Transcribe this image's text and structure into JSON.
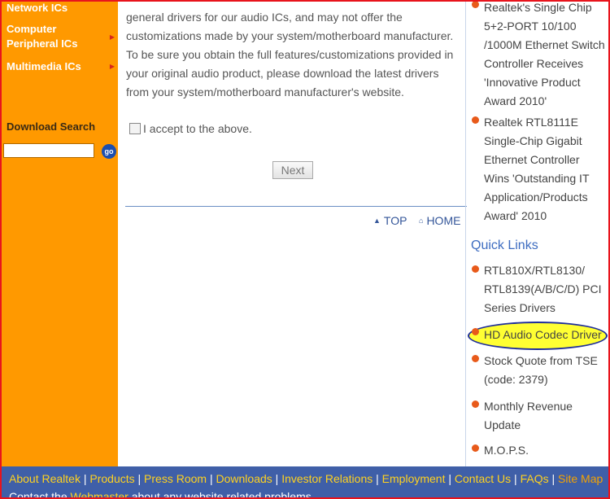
{
  "sidebar": {
    "items": [
      {
        "label": "Network ICs"
      },
      {
        "label": "Computer Peripheral ICs"
      },
      {
        "label": "Multimedia ICs"
      }
    ],
    "download_title": "Download Search",
    "go_label": "go"
  },
  "main": {
    "paragraph": "general drivers for our audio ICs, and may not offer the customizations made by your system/motherboard manufacturer. To be sure you obtain the full features/customizations provided in your original audio product, please download the latest drivers from your system/motherboard manufacturer's website.",
    "accept_label": "I accept to the above.",
    "next_label": "Next",
    "top_label": "TOP",
    "home_label": "HOME"
  },
  "right": {
    "news": [
      {
        "text": "Realtek's Single Chip 5+2-PORT 10/100 /1000M Ethernet Switch Controller Receives 'Innovative Product Award 2010'"
      },
      {
        "text": "Realtek RTL8111E Single-Chip Gigabit Ethernet Controller Wins 'Outstanding IT Application/Products Award' 2010"
      }
    ],
    "quick_links_title": "Quick Links",
    "quick_links": [
      {
        "text": "RTL810X/RTL8130/ RTL8139(A/B/C/D) PCI Series Drivers"
      },
      {
        "text": "HD Audio Codec Driver"
      },
      {
        "text": "Stock Quote from TSE (code: 2379)"
      },
      {
        "text": "Monthly Revenue Update"
      },
      {
        "text": "M.O.P.S."
      }
    ]
  },
  "footer": {
    "links": [
      "About Realtek",
      "Products",
      "Press Room",
      "Downloads",
      "Investor Relations",
      "Employment",
      "Contact Us",
      "FAQs",
      "Site Map"
    ],
    "contact_prefix": "Contact the",
    "webmaster": "Webmaster",
    "contact_suffix": "about any website related problems."
  },
  "colors": {
    "sidebar": "#ff9900",
    "footer": "#3f5fa8",
    "accent": "#3d6cc0",
    "highlight": "#ffff33",
    "border": "#e8141c"
  }
}
